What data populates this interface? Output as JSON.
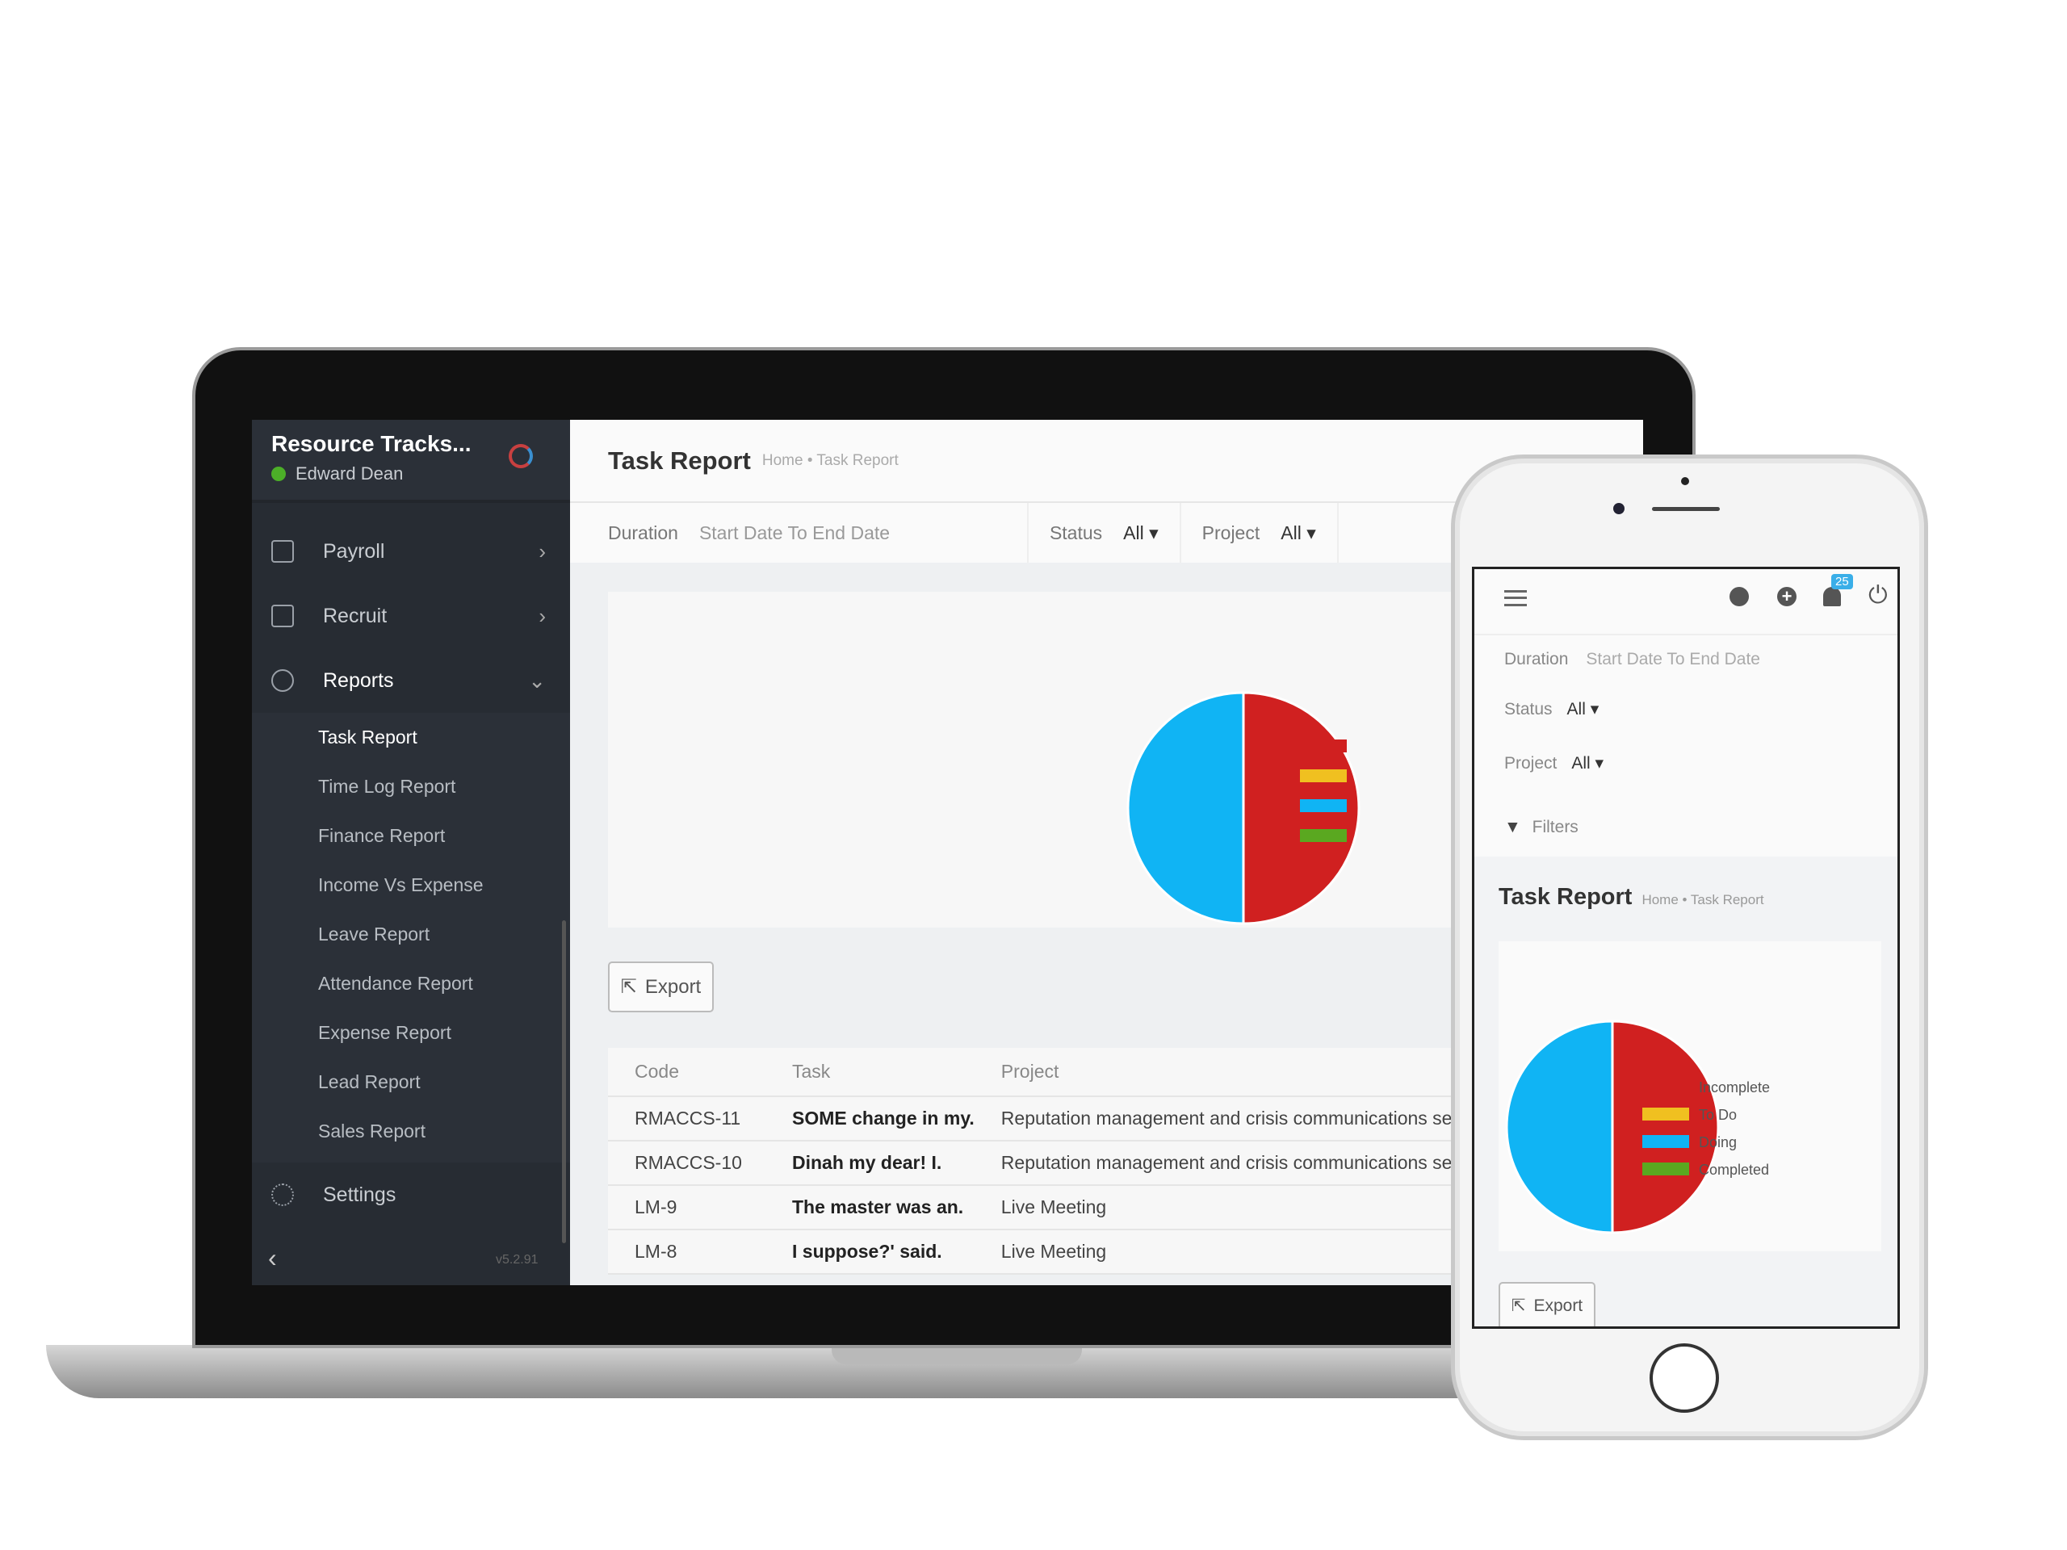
{
  "sidebar": {
    "app_title": "Resource Tracks...",
    "user": "Edward Dean",
    "version": "v5.2.91",
    "menu": [
      {
        "label": "Payroll",
        "icon": "calendar-icon"
      },
      {
        "label": "Recruit",
        "icon": "id-card-icon"
      },
      {
        "label": "Reports",
        "icon": "pie-chart-icon"
      }
    ],
    "reports_sub": [
      "Task Report",
      "Time Log Report",
      "Finance Report",
      "Income Vs Expense",
      "Leave Report",
      "Attendance Report",
      "Expense Report",
      "Lead Report",
      "Sales Report"
    ],
    "settings": "Settings"
  },
  "header": {
    "title": "Task Report",
    "breadcrumb": "Home • Task Report"
  },
  "filters": {
    "duration_label": "Duration",
    "duration_value": "Start Date To End Date",
    "status_label": "Status",
    "status_value": "All",
    "project_label": "Project",
    "project_value": "All",
    "filters_label": "Filters"
  },
  "export_label": "Export",
  "table": {
    "columns": [
      "Code",
      "Task",
      "Project"
    ],
    "rows": [
      [
        "RMACCS-11",
        "SOME change in my.",
        "Reputation management and crisis communications service"
      ],
      [
        "RMACCS-10",
        "Dinah my dear! I.",
        "Reputation management and crisis communications service"
      ],
      [
        "LM-9",
        "The master was an.",
        "Live Meeting"
      ],
      [
        "LM-8",
        "I suppose?' said.",
        "Live Meeting"
      ]
    ]
  },
  "phone": {
    "notification_count": "25"
  },
  "chart_data": {
    "type": "pie",
    "categories": [
      "Incomplete",
      "To Do",
      "Doing",
      "Completed"
    ],
    "values": [
      50,
      0,
      50,
      0
    ],
    "colors": [
      "#d02020",
      "#f0c020",
      "#10b4f4",
      "#5aa820"
    ],
    "legend": "right"
  }
}
